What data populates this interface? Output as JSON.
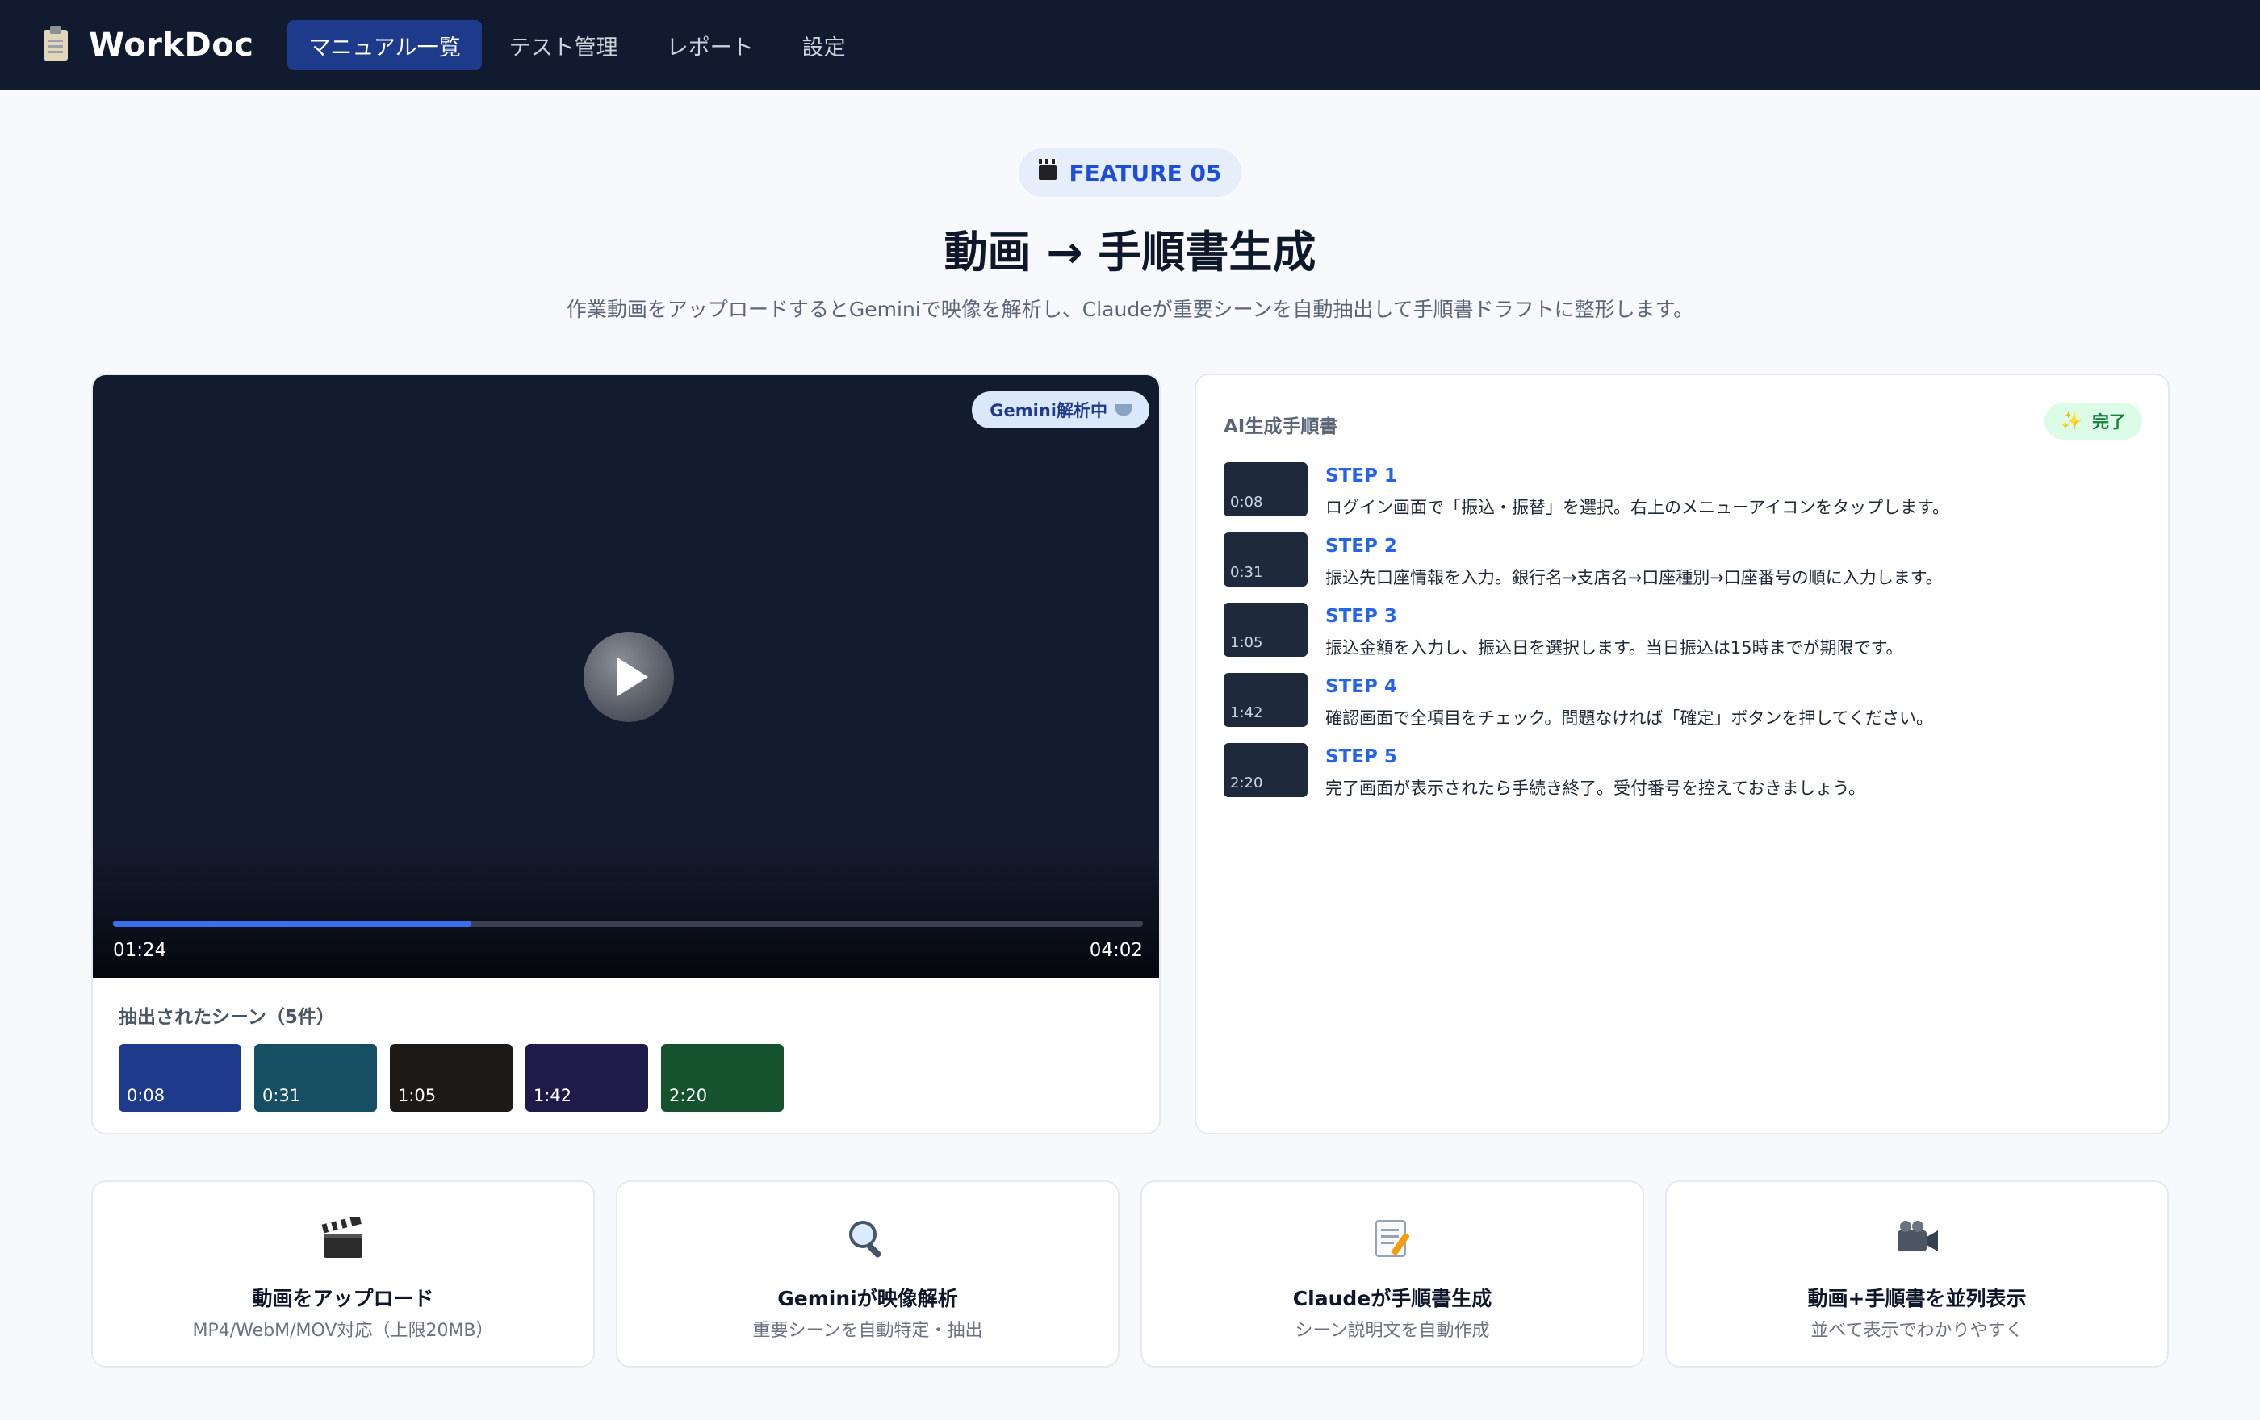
{
  "nav": {
    "brand": "WorkDoc",
    "items": [
      {
        "label": "マニュアル一覧",
        "active": true
      },
      {
        "label": "テスト管理",
        "active": false
      },
      {
        "label": "レポート",
        "active": false
      },
      {
        "label": "設定",
        "active": false
      }
    ]
  },
  "hero": {
    "badge": "FEATURE 05",
    "title": "動画 → 手順書生成",
    "subtitle": "作業動画をアップロードするとGeminiで映像を解析し、Claudeが重要シーンを自動抽出して手順書ドラフトに整形します。"
  },
  "video": {
    "status_pill": "Gemini解析中",
    "current_time": "01:24",
    "total_time": "04:02",
    "progress": 0.348,
    "scenes_title": "抽出されたシーン（5件）",
    "scenes": [
      {
        "time": "0:08",
        "color": "#1e3a8a"
      },
      {
        "time": "0:31",
        "color": "#164e63"
      },
      {
        "time": "1:05",
        "color": "#1c1917"
      },
      {
        "time": "1:42",
        "color": "#1e1b4b"
      },
      {
        "time": "2:20",
        "color": "#14532d"
      }
    ]
  },
  "steps_panel": {
    "title": "AI生成手順書",
    "status": "完了",
    "steps": [
      {
        "label": "STEP 1",
        "time": "0:08",
        "text": "ログイン画面で「振込・振替」を選択。右上のメニューアイコンをタップします。"
      },
      {
        "label": "STEP 2",
        "time": "0:31",
        "text": "振込先口座情報を入力。銀行名→支店名→口座種別→口座番号の順に入力します。"
      },
      {
        "label": "STEP 3",
        "time": "1:05",
        "text": "振込金額を入力し、振込日を選択します。当日振込は15時までが期限です。"
      },
      {
        "label": "STEP 4",
        "time": "1:42",
        "text": "確認画面で全項目をチェック。問題なければ「確定」ボタンを押してください。"
      },
      {
        "label": "STEP 5",
        "time": "2:20",
        "text": "完了画面が表示されたら手続き終了。受付番号を控えておきましょう。"
      }
    ]
  },
  "features": [
    {
      "icon": "clapperboard-icon",
      "title": "動画をアップロード",
      "desc": "MP4/WebM/MOV対応（上限20MB）"
    },
    {
      "icon": "magnifier-icon",
      "title": "Geminiが映像解析",
      "desc": "重要シーンを自動特定・抽出"
    },
    {
      "icon": "memo-icon",
      "title": "Claudeが手順書生成",
      "desc": "シーン説明文を自動作成"
    },
    {
      "icon": "video-camera-icon",
      "title": "動画+手順書を並列表示",
      "desc": "並べて表示でわかりやすく"
    }
  ]
}
